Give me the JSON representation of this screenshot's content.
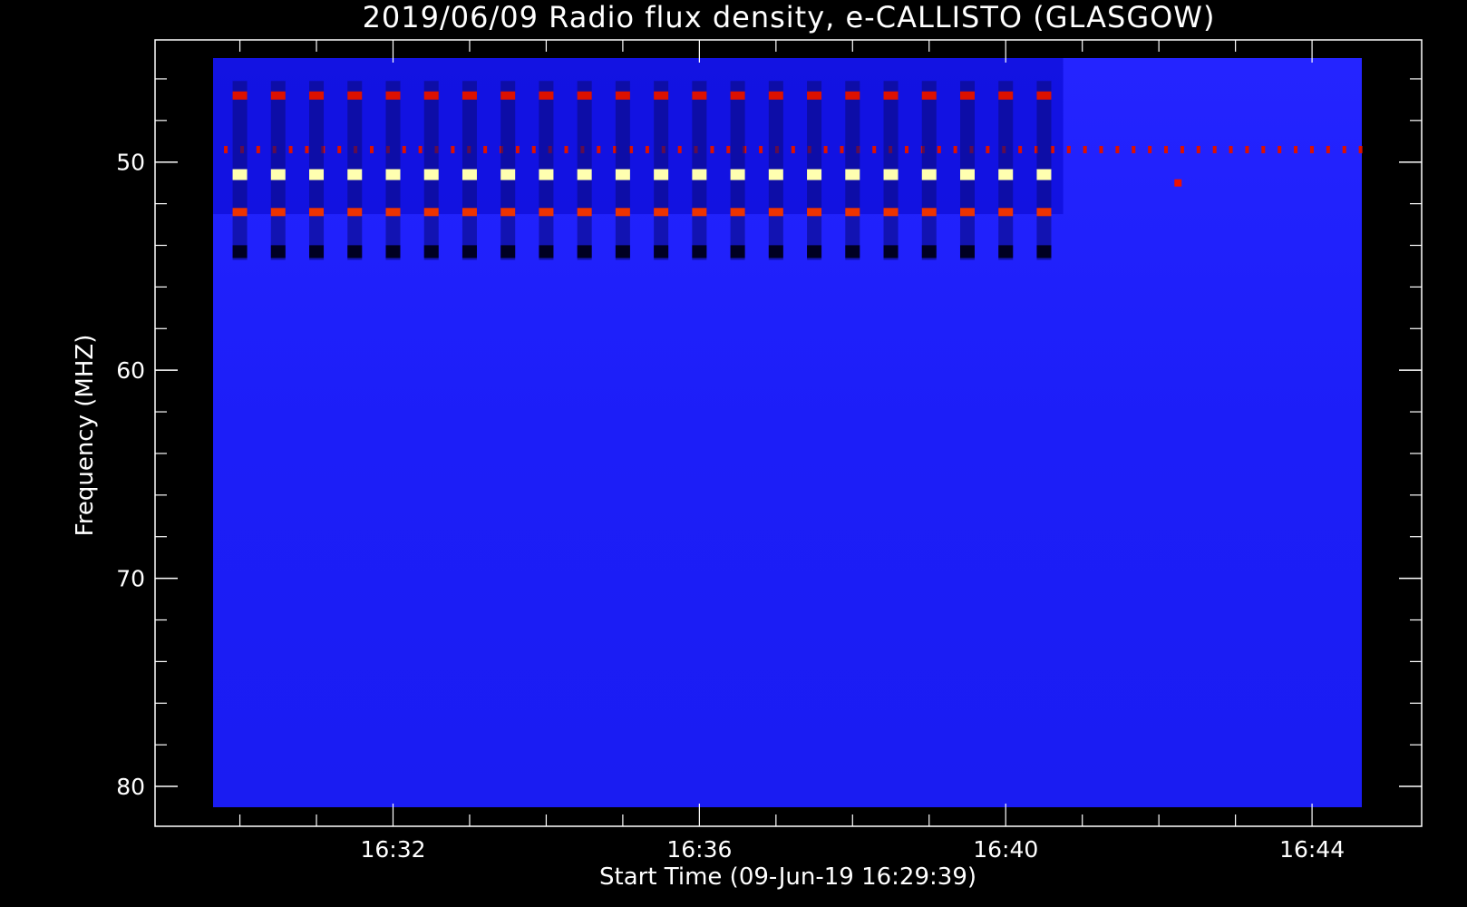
{
  "chart_data": {
    "type": "heatmap",
    "title": "2019/06/09  Radio flux density, e-CALLISTO (GLASGOW)",
    "xlabel": "Start Time (09-Jun-19 16:29:39)",
    "ylabel": "Frequency (MHZ)",
    "x_start": "16:29:39",
    "x_end": "16:44:39",
    "ylim": [
      45,
      81
    ],
    "y_direction": "inverted",
    "x_ticks": [
      "16:32",
      "16:36",
      "16:40",
      "16:44"
    ],
    "y_ticks": [
      50,
      60,
      70,
      80
    ],
    "colormap": [
      "#000010",
      "#1a1aff",
      "#cc0000",
      "#ff6600",
      "#ffffa0"
    ],
    "background_color": "#1a1aff",
    "features": {
      "periodic_bursts": {
        "period_s": 30,
        "first_time": "16:30:00",
        "last_time": "16:40:30",
        "bands": [
          {
            "freq_mhz": 46.8,
            "intensity": "high",
            "color": "#dd1100"
          },
          {
            "freq_mhz": 50.6,
            "intensity": "very-high",
            "color": "#ffffb0"
          },
          {
            "freq_mhz": 52.4,
            "intensity": "high",
            "color": "#ee3300"
          },
          {
            "freq_mhz": 54.3,
            "intensity": "low",
            "color": "#000022"
          }
        ]
      },
      "continuous_line": {
        "freq_mhz": 49.4,
        "from": "16:29:39",
        "to": "16:44:39",
        "color": "#dd1100"
      },
      "isolated_spot": {
        "time": "16:42:15",
        "freq_mhz": 51.0,
        "color": "#ee1100"
      }
    }
  }
}
